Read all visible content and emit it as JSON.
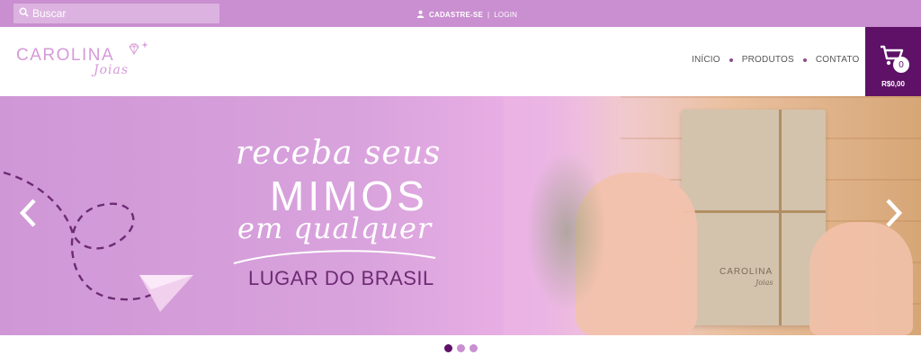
{
  "topbar": {
    "search_placeholder": "Buscar",
    "signup_label": "CADASTRE-SE",
    "separator": "|",
    "login_label": "LOGIN"
  },
  "header": {
    "logo": {
      "name": "CAROLINA",
      "sub": "Joias"
    },
    "nav": [
      {
        "label": "INÍCIO"
      },
      {
        "label": "PRODUTOS"
      },
      {
        "label": "CONTATO"
      }
    ],
    "cart": {
      "count": "0",
      "total": "R$0,00"
    }
  },
  "banner": {
    "line1": "receba seus",
    "line2": "MIMOS",
    "line3": "em qualquer",
    "line4": "LUGAR DO BRASIL",
    "box_logo_name": "CAROLINA",
    "box_logo_sub": "Joias"
  },
  "slider": {
    "active_index": 0,
    "count": 3
  },
  "colors": {
    "topbar": "#c98fd0",
    "accent": "#5e1166",
    "logo": "#d69ad8",
    "dot_active": "#5e1166",
    "dot_inactive": "#c98fd0"
  },
  "icons": {
    "search": "search-icon",
    "user": "user-icon",
    "cart": "cart-icon",
    "prev": "chevron-left-icon",
    "next": "chevron-right-icon"
  }
}
